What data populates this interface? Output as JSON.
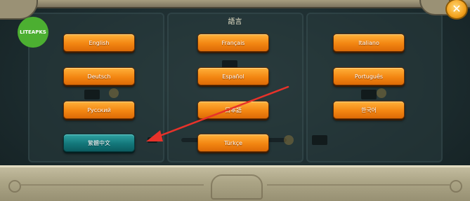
{
  "dialog": {
    "title": "語言"
  },
  "languages": [
    {
      "label": "English",
      "selected": false
    },
    {
      "label": "Français",
      "selected": false
    },
    {
      "label": "Italiano",
      "selected": false
    },
    {
      "label": "Deutsch",
      "selected": false
    },
    {
      "label": "Español",
      "selected": false
    },
    {
      "label": "Português",
      "selected": false
    },
    {
      "label": "Русский",
      "selected": false
    },
    {
      "label": "日本語",
      "selected": false
    },
    {
      "label": "한국어",
      "selected": false
    },
    {
      "label": "繁體中文",
      "selected": true
    },
    {
      "label": "Türkçe",
      "selected": false
    }
  ],
  "close": {
    "icon": "x-icon",
    "glyph": "✕"
  },
  "watermark": {
    "text": "LITEAPKS",
    "color": "#4caf31"
  },
  "annotation": {
    "arrow_color": "#e8322a"
  },
  "colors": {
    "button_orange": "#f38612",
    "button_selected_teal": "#13777a",
    "panel_stone": "#aca586"
  }
}
